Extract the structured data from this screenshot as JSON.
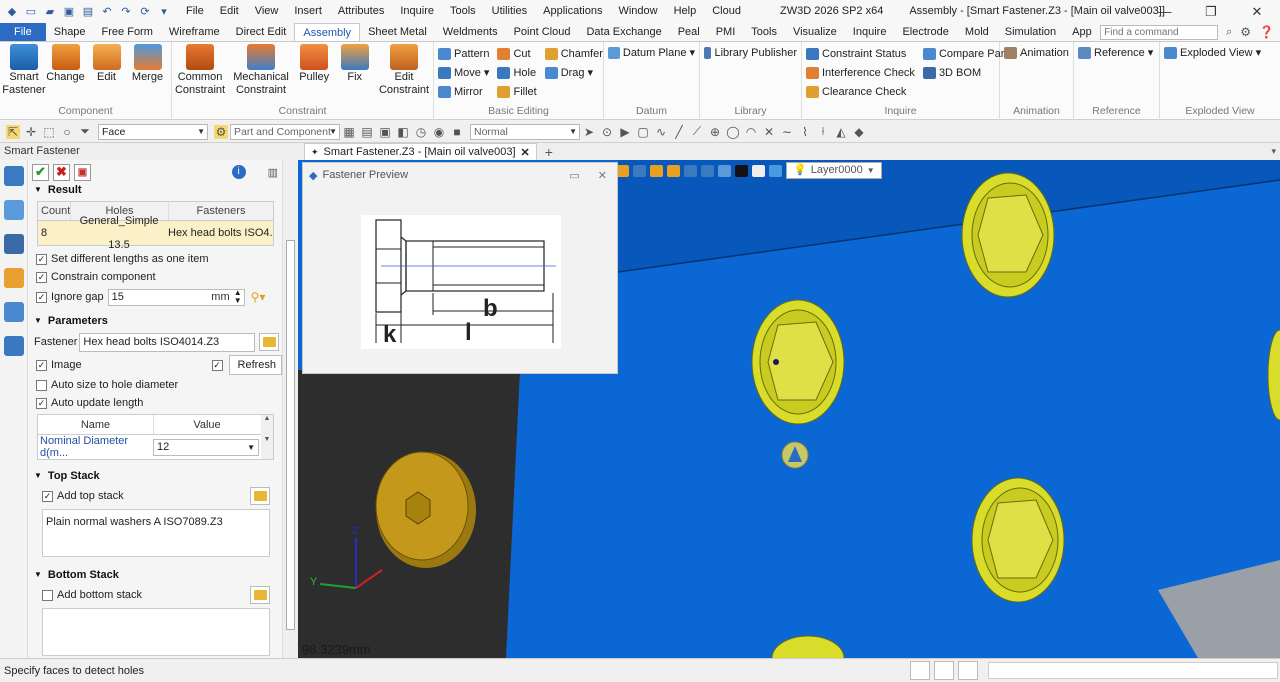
{
  "titlebar": {
    "menus": [
      "File",
      "Edit",
      "View",
      "Insert",
      "Attributes",
      "Inquire",
      "Tools",
      "Utilities",
      "Applications",
      "Window",
      "Help",
      "Cloud"
    ],
    "app_version": "ZW3D 2026 SP2 x64",
    "doc_title": "Assembly - [Smart Fastener.Z3 - [Main oil valve003]]"
  },
  "tabs": [
    "File",
    "Shape",
    "Free Form",
    "Wireframe",
    "Direct Edit",
    "Assembly",
    "Sheet Metal",
    "Weldments",
    "Point Cloud",
    "Data Exchange",
    "Peal",
    "PMI",
    "Tools",
    "Visualize",
    "Inquire",
    "Electrode",
    "Mold",
    "Simulation",
    "App"
  ],
  "active_tab": "Assembly",
  "command_search_placeholder": "Find a command",
  "ribbon": {
    "component": {
      "title": "Component",
      "buttons": [
        "Smart Fastener",
        "Change",
        "Edit",
        "Merge"
      ]
    },
    "constraint": {
      "title": "Constraint",
      "buttons": [
        "Common Constraint",
        "Mechanical Constraint",
        "Pulley",
        "Fix",
        "Edit Constraint"
      ]
    },
    "basic_editing": {
      "title": "Basic Editing",
      "col1": [
        "Pattern",
        "Move",
        "Mirror"
      ],
      "col2": [
        "Cut",
        "Hole",
        "Fillet"
      ],
      "col3": [
        "Chamfer",
        "Drag"
      ]
    },
    "datum": {
      "title": "Datum",
      "button": "Datum Plane"
    },
    "library": {
      "title": "Library",
      "button": "Library Publisher"
    },
    "inquire": {
      "title": "Inquire",
      "col1": [
        "Constraint Status",
        "Interference Check",
        "Clearance Check"
      ],
      "col2": [
        "Compare Parts",
        "3D BOM"
      ]
    },
    "animation": {
      "title": "Animation",
      "button": "Animation"
    },
    "reference": {
      "title": "Reference",
      "button": "Reference"
    },
    "exploded": {
      "title": "Exploded View",
      "button": "Exploded View"
    }
  },
  "toolbar": {
    "filter": "Face",
    "scope": "Part and Component",
    "render_mode": "Normal"
  },
  "panel": {
    "title": "Smart Fastener",
    "result": {
      "header": "Result",
      "columns": [
        "Count",
        "Holes",
        "Fasteners"
      ],
      "row": {
        "count": "8",
        "holes": "General_Simple 13.5",
        "fasteners": "Hex head bolts ISO4..."
      },
      "opt_diff_lengths": "Set different lengths as one item",
      "opt_constrain": "Constrain component",
      "ignore_gap_label": "Ignore gap",
      "ignore_gap_value": "15",
      "ignore_gap_unit": "mm"
    },
    "parameters": {
      "header": "Parameters",
      "fastener_label": "Fastener",
      "fastener_value": "Hex head bolts ISO4014.Z3",
      "image_label": "Image",
      "refresh": "Refresh",
      "auto_size": "Auto size to hole diameter",
      "auto_update": "Auto update length",
      "col_name": "Name",
      "col_value": "Value",
      "param_name": "Nominal Diameter d(m...",
      "param_value": "12"
    },
    "top_stack": {
      "header": "Top Stack",
      "add_label": "Add top stack",
      "item": "Plain normal washers A ISO7089.Z3"
    },
    "bottom_stack": {
      "header": "Bottom Stack",
      "add_label": "Add bottom stack"
    }
  },
  "doc_tab": "Smart Fastener.Z3 - [Main oil valve003]",
  "preview": {
    "title": "Fastener Preview",
    "labels": {
      "k": "k",
      "l": "l",
      "b": "b"
    }
  },
  "viewport": {
    "layer": "Layer0000",
    "measure": "98.3239mm",
    "axis_y": "Y",
    "axis_z": "Z",
    "bg_color": "#0b67d3",
    "part_color": "#d8dc2a"
  },
  "status": {
    "message": "Specify faces to detect holes"
  }
}
